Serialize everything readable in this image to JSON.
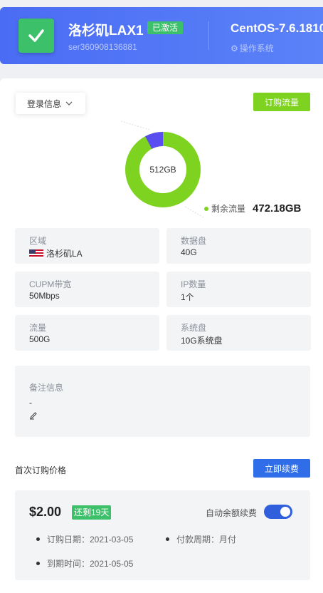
{
  "header": {
    "server_name": "洛杉矶LAX1",
    "status_badge": "已激活",
    "server_id": "ser360908136881",
    "os_name": "CentOS-7.6.1810",
    "os_label": "操作系统"
  },
  "toolbar": {
    "login_info": "登录信息",
    "buy_traffic": "订购流量"
  },
  "traffic": {
    "total": "512GB",
    "remaining_label": "剩余流量",
    "remaining_value": "472.18GB",
    "used_fraction": 0.078,
    "colors": {
      "remaining": "#7ed321",
      "used": "#5b4ef0"
    }
  },
  "specs": [
    {
      "key": "区域",
      "value": "洛杉矶LA",
      "flag": "us-flag-icon"
    },
    {
      "key": "数据盘",
      "value": "40G"
    },
    {
      "key": "CUPM带宽",
      "value": "50Mbps"
    },
    {
      "key": "IP数量",
      "value": "1个"
    },
    {
      "key": "流量",
      "value": "500G"
    },
    {
      "key": "系统盘",
      "value": "10G系统盘"
    }
  ],
  "note": {
    "label": "备注信息",
    "value": "-",
    "edit_icon": "pencil-icon"
  },
  "price": {
    "title": "首次订购价格",
    "renew_button": "立即续费",
    "amount": "$2.00",
    "remaining_days": "还剩19天",
    "auto_renew_label": "自动余额续费",
    "auto_renew_on": true,
    "order_date": "订购日期：2021-03-05",
    "pay_cycle": "付款周期：月付",
    "expire_date": "到期时间：2021-05-05"
  }
}
